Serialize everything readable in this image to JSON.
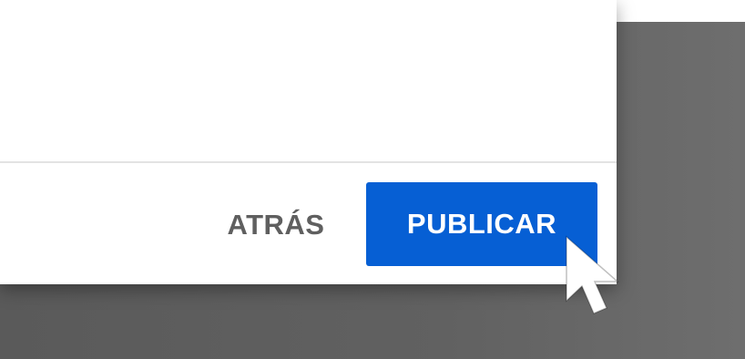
{
  "dialog": {
    "footer": {
      "back_label": "ATRÁS",
      "publish_label": "PUBLICAR"
    }
  },
  "colors": {
    "primary_button": "#065fd4",
    "primary_text": "#ffffff",
    "secondary_text": "#5f5f5f",
    "overlay": "#606060"
  },
  "icons": {
    "cursor": "mouse-pointer-icon"
  }
}
